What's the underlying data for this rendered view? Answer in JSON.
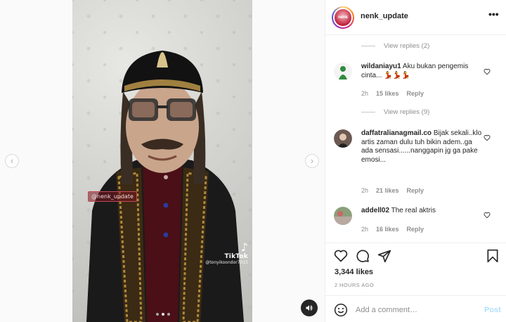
{
  "post": {
    "username": "nenk_update",
    "avatar_text": "nenk"
  },
  "media": {
    "watermark": "@nenk_update",
    "tiktok_label": "TikTok",
    "tiktok_handle": "@tonyikoondor7015",
    "carousel_count": 3,
    "carousel_active": 1
  },
  "comments": {
    "replies_top": "View replies (2)",
    "items": [
      {
        "user": "wildaniayu1",
        "text": "Aku bukan pengemis cinta... 💃💃💃",
        "time": "2h",
        "likes": "15 likes",
        "reply": "Reply",
        "replies": "View replies (9)"
      },
      {
        "user": "daffatralianagmail.co",
        "text": "Bijak sekali..klo artis zaman dulu tuh bikin adem..ga ada sensasi......nanggapin jg ga pake emosi...",
        "time": "2h",
        "likes": "21 likes",
        "reply": "Reply"
      },
      {
        "user": "addell02",
        "text": "The real aktris",
        "time": "2h",
        "likes": "16 likes",
        "reply": "Reply"
      }
    ]
  },
  "actions": {
    "likes": "3,344 likes",
    "posted": "2 HOURS AGO"
  },
  "composer": {
    "placeholder": "Add a comment…",
    "post_label": "Post"
  },
  "icons": {
    "more": "more-icon",
    "like": "heart-icon",
    "comment": "comment-icon",
    "share": "share-icon",
    "save": "bookmark-icon",
    "emoji": "emoji-icon",
    "sound": "speaker-icon"
  }
}
